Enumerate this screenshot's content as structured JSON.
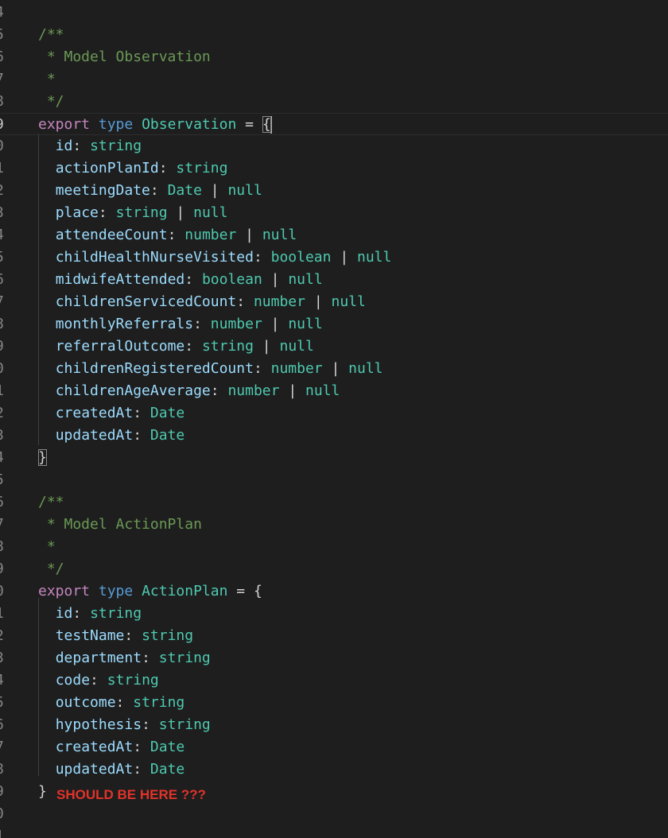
{
  "gutter": {
    "line_numbers": [
      "4",
      "5",
      "6",
      "7",
      "8",
      "9",
      "0",
      "1",
      "2",
      "3",
      "4",
      "5",
      "6",
      "7",
      "8",
      "9",
      "0",
      "1",
      "2",
      "3",
      "4",
      "5",
      "6",
      "7",
      "8",
      "9",
      "0",
      "1",
      "2",
      "3",
      "4",
      "5",
      "6",
      "7",
      "8",
      "9",
      "0",
      "1"
    ],
    "active_line_number": "9"
  },
  "observation": {
    "doc_open": "/**",
    "doc_title": " * Model Observation",
    "doc_star": " *",
    "doc_close": " */",
    "export_kw": "export",
    "type_kw": "type",
    "type_name": "Observation",
    "equals": "=",
    "open_brace": "{",
    "close_brace": "}",
    "fields": [
      {
        "name": "id",
        "type": "string",
        "nullable": ""
      },
      {
        "name": "actionPlanId",
        "type": "string",
        "nullable": ""
      },
      {
        "name": "meetingDate",
        "type": "Date",
        "nullable": "null"
      },
      {
        "name": "place",
        "type": "string",
        "nullable": "null"
      },
      {
        "name": "attendeeCount",
        "type": "number",
        "nullable": "null"
      },
      {
        "name": "childHealthNurseVisited",
        "type": "boolean",
        "nullable": "null"
      },
      {
        "name": "midwifeAttended",
        "type": "boolean",
        "nullable": "null"
      },
      {
        "name": "childrenServicedCount",
        "type": "number",
        "nullable": "null"
      },
      {
        "name": "monthlyReferrals",
        "type": "number",
        "nullable": "null"
      },
      {
        "name": "referralOutcome",
        "type": "string",
        "nullable": "null"
      },
      {
        "name": "childrenRegisteredCount",
        "type": "number",
        "nullable": "null"
      },
      {
        "name": "childrenAgeAverage",
        "type": "number",
        "nullable": "null"
      },
      {
        "name": "createdAt",
        "type": "Date",
        "nullable": ""
      },
      {
        "name": "updatedAt",
        "type": "Date",
        "nullable": ""
      }
    ]
  },
  "action_plan": {
    "doc_open": "/**",
    "doc_title": " * Model ActionPlan",
    "doc_star": " *",
    "doc_close": " */",
    "export_kw": "export",
    "type_kw": "type",
    "type_name": "ActionPlan",
    "equals": "=",
    "open_brace": "{",
    "close_brace": "}",
    "fields": [
      {
        "name": "id",
        "type": "string"
      },
      {
        "name": "testName",
        "type": "string"
      },
      {
        "name": "department",
        "type": "string"
      },
      {
        "name": "code",
        "type": "string"
      },
      {
        "name": "outcome",
        "type": "string"
      },
      {
        "name": "hypothesis",
        "type": "string"
      },
      {
        "name": "createdAt",
        "type": "Date"
      },
      {
        "name": "updatedAt",
        "type": "Date"
      }
    ]
  },
  "annotation": {
    "text": "SHOULD BE HERE ???",
    "color": "#e2332a"
  },
  "colors": {
    "background": "#1e1e1e",
    "comment": "#6a9955",
    "keyword": "#c586c0",
    "type_keyword": "#569cd6",
    "type_name": "#4ec9b0",
    "property": "#9cdcfe"
  }
}
